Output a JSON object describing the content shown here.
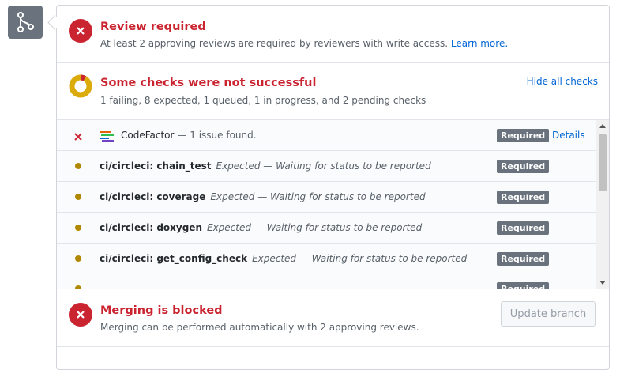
{
  "review": {
    "title": "Review required",
    "description": "At least 2 approving reviews are required by reviewers with write access.",
    "learn_more": "Learn more."
  },
  "checks_summary": {
    "title": "Some checks were not successful",
    "description": "1 failing, 8 expected, 1 queued, 1 in progress, and 2 pending checks",
    "hide_link": "Hide all checks",
    "progress": {
      "failing_fraction": 0.08
    }
  },
  "checks": [
    {
      "context": "CodeFactor",
      "status": "— 1 issue found.",
      "state": "failure",
      "badge": "Required",
      "details": "Details"
    },
    {
      "context": "ci/circleci: chain_test",
      "status": "Expected — Waiting for status to be reported",
      "state": "expected",
      "badge": "Required"
    },
    {
      "context": "ci/circleci: coverage",
      "status": "Expected — Waiting for status to be reported",
      "state": "expected",
      "badge": "Required"
    },
    {
      "context": "ci/circleci: doxygen",
      "status": "Expected — Waiting for status to be reported",
      "state": "expected",
      "badge": "Required"
    },
    {
      "context": "ci/circleci: get_config_check",
      "status": "Expected — Waiting for status to be reported",
      "state": "expected",
      "badge": "Required"
    }
  ],
  "merge": {
    "title": "Merging is blocked",
    "description": "Merging can be performed automatically with 2 approving reviews.",
    "update_button": "Update branch"
  },
  "colors": {
    "error": "#cb2431",
    "pending": "#b08800",
    "link": "#0366d6",
    "badge": "#6a737d"
  },
  "icons": {
    "merge": "git-merge-icon",
    "review_status": "x-circle-icon",
    "checks_status": "progress-ring-icon",
    "codefactor": "codefactor-logo-icon",
    "merge_status": "x-circle-icon"
  }
}
